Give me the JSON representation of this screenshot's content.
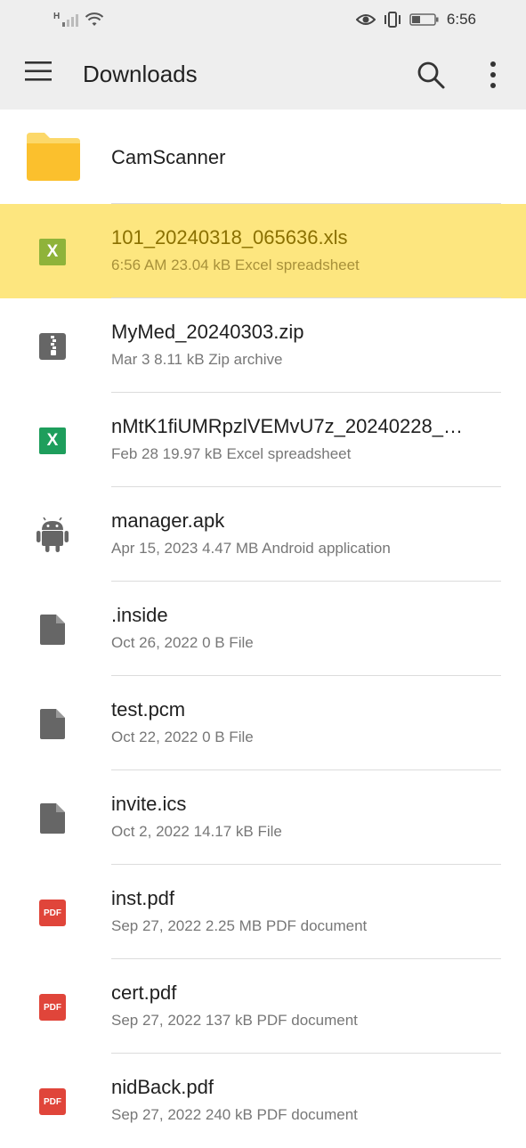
{
  "status_bar": {
    "network": "H",
    "time": "6:56"
  },
  "app_bar": {
    "title": "Downloads",
    "menu_icon": "hamburger-menu-icon",
    "search_icon": "search-icon",
    "more_icon": "more-vert-icon"
  },
  "colors": {
    "selected_row": "#fde67f",
    "xls_green": "#1e9e5c",
    "pdf_red": "#e0453a",
    "folder_yellow": "#fbc02d"
  },
  "files": [
    {
      "name": "CamScanner",
      "meta": "",
      "icon": "folder-icon",
      "type": "folder"
    },
    {
      "name": "101_20240318_065636.xls",
      "meta": "6:56 AM  23.04 kB  Excel spreadsheet",
      "icon": "excel-icon",
      "type": "xls",
      "selected": true
    },
    {
      "name": "MyMed_20240303.zip",
      "meta": "Mar 3  8.11 kB  Zip archive",
      "icon": "zip-icon",
      "type": "zip"
    },
    {
      "name": "nMtK1fiUMRpzlVEMvU7z_20240228_…",
      "meta": "Feb 28  19.97 kB  Excel spreadsheet",
      "icon": "excel-icon",
      "type": "xls"
    },
    {
      "name": "manager.apk",
      "meta": "Apr 15, 2023  4.47 MB  Android application",
      "icon": "android-icon",
      "type": "apk"
    },
    {
      "name": ".inside",
      "meta": "Oct 26, 2022  0 B  File",
      "icon": "file-icon",
      "type": "file"
    },
    {
      "name": "test.pcm",
      "meta": "Oct 22, 2022  0 B  File",
      "icon": "file-icon",
      "type": "file"
    },
    {
      "name": "invite.ics",
      "meta": "Oct 2, 2022  14.17 kB  File",
      "icon": "file-icon",
      "type": "file"
    },
    {
      "name": "inst.pdf",
      "meta": "Sep 27, 2022  2.25 MB  PDF document",
      "icon": "pdf-icon",
      "type": "pdf"
    },
    {
      "name": "cert.pdf",
      "meta": "Sep 27, 2022  137 kB  PDF document",
      "icon": "pdf-icon",
      "type": "pdf"
    },
    {
      "name": "nidBack.pdf",
      "meta": "Sep 27, 2022  240 kB  PDF document",
      "icon": "pdf-icon",
      "type": "pdf"
    }
  ],
  "icon_labels": {
    "xls": "X",
    "pdf": "PDF"
  }
}
